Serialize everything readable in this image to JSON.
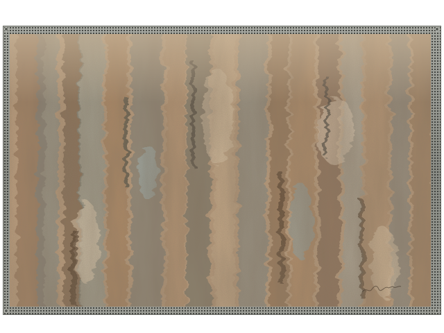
{
  "artwork": {
    "subject": "abstract-painting-in-perforated-metal-frame",
    "palette": {
      "base": "#b89a7a",
      "ochre": "#a07650",
      "umber": "#5e4630",
      "slate": "#6f8489",
      "teal_grey": "#7f9a9c",
      "cream": "#e2cdb0",
      "frame_metal": "#8e9089"
    },
    "frame": {
      "material": "perforated-steel",
      "icon": "frame-border"
    },
    "signature": {
      "text": "",
      "placement": "bottom-right"
    }
  }
}
